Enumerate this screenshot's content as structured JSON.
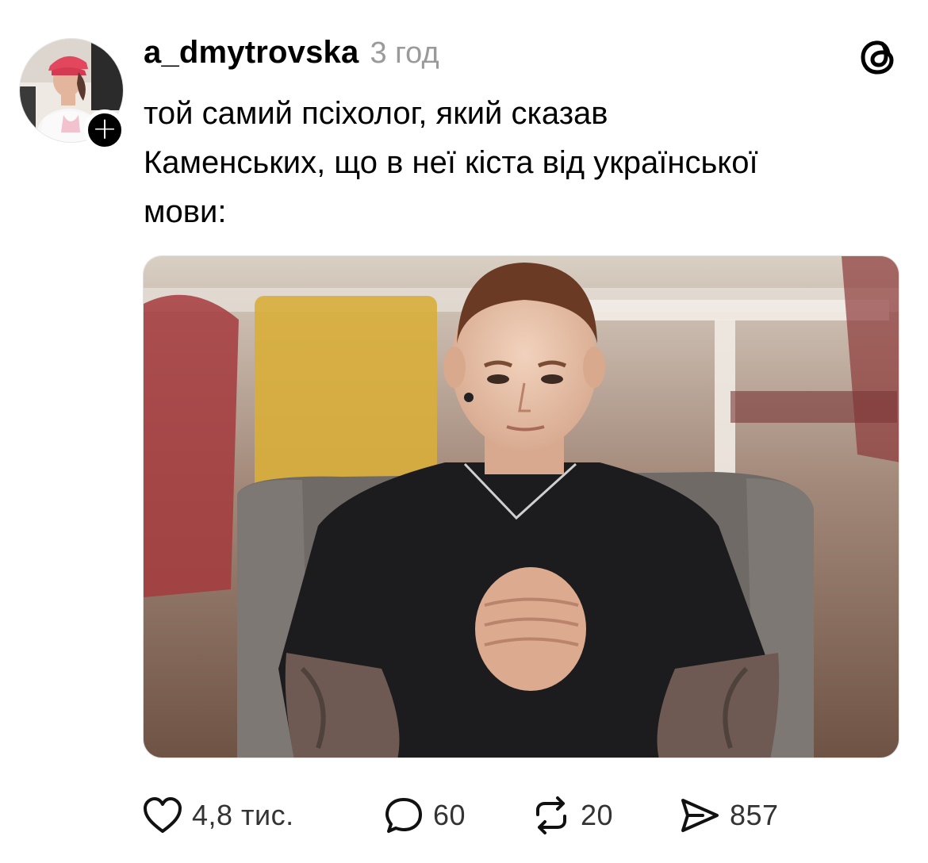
{
  "post": {
    "username": "a_dmytrovska",
    "timestamp": "3 год",
    "text": "той самий псіхолог, який сказав\nКаменських, що в неї кіста від української\nмови:"
  },
  "actions": {
    "likes": "4,8 тис.",
    "comments": "60",
    "reposts": "20",
    "shares": "857"
  },
  "icons": {
    "follow": "plus-icon",
    "app": "threads-logo-icon",
    "like": "heart-icon",
    "comment": "comment-bubble-icon",
    "repost": "repost-icon",
    "share": "send-icon"
  },
  "colors": {
    "text": "#000000",
    "muted": "#9a9a9a",
    "counts": "#333333"
  }
}
